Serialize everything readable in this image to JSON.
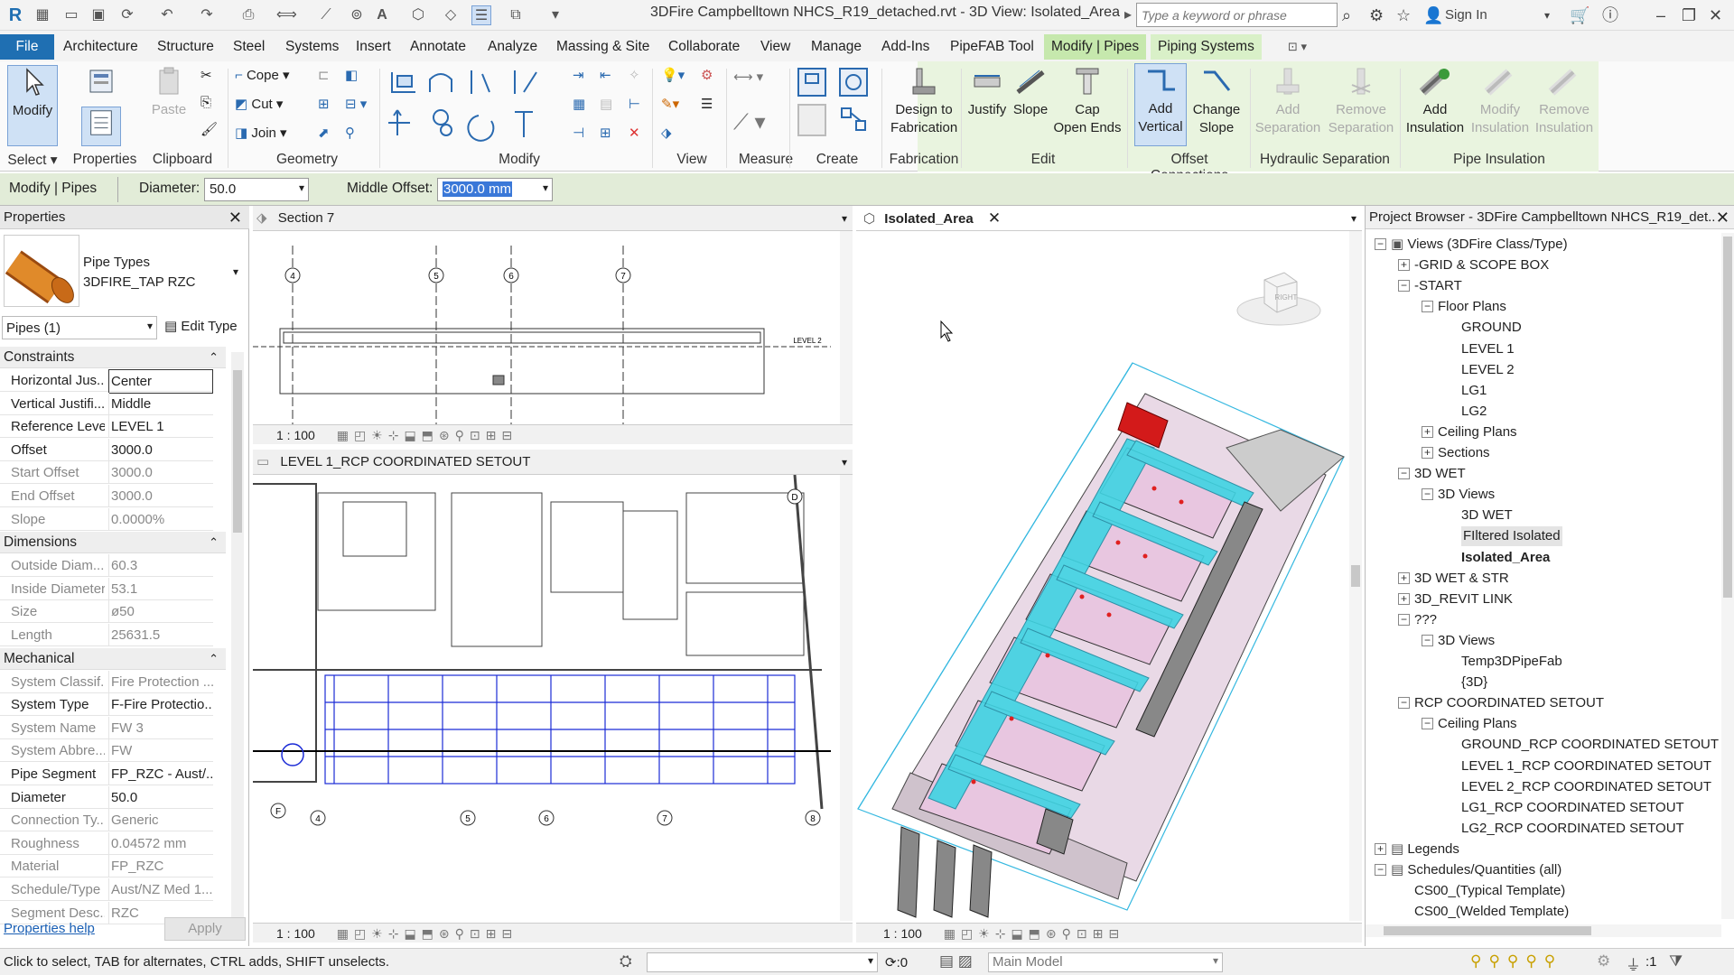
{
  "titlebar": {
    "title": "3DFire Campbelltown NHCS_R19_detached.rvt - 3D View: Isolated_Area",
    "search_placeholder": "Type a keyword or phrase",
    "sign_in": "Sign In"
  },
  "menu": {
    "file": "File",
    "tabs": [
      "Architecture",
      "Structure",
      "Steel",
      "Systems",
      "Insert",
      "Annotate",
      "Analyze",
      "Massing & Site",
      "Collaborate",
      "View",
      "Manage",
      "Add-Ins",
      "PipeFAB Tool"
    ],
    "context_tabs": [
      "Modify | Pipes",
      "Piping Systems"
    ]
  },
  "ribbon": {
    "modify": "Modify",
    "select": "Select",
    "paste": "Paste",
    "properties": "Properties",
    "clipboard": "Clipboard",
    "cope": "Cope",
    "cut": "Cut",
    "join": "Join",
    "geometry": "Geometry",
    "modify_panel": "Modify",
    "view_panel": "View",
    "measure": "Measure",
    "create": "Create",
    "design_to": "Design to",
    "fabrication_btn": "Fabrication",
    "fabrication": "Fabrication",
    "justify": "Justify",
    "slope": "Slope",
    "cap": "Cap",
    "open_ends": "Open Ends",
    "edit": "Edit",
    "add": "Add",
    "vertical": "Vertical",
    "change": "Change",
    "slope2": "Slope",
    "offset_connections": "Offset Connections",
    "add_sep": "Add",
    "separation": "Separation",
    "remove_sep": "Remove",
    "separation2": "Separation",
    "hydraulic_separation": "Hydraulic Separation",
    "add_ins": "Add",
    "insulation": "Insulation",
    "modify_ins": "Modify",
    "insulation2": "Insulation",
    "remove_ins": "Remove",
    "insulation3": "Insulation",
    "pipe_insulation": "Pipe Insulation"
  },
  "optionsbar": {
    "context": "Modify | Pipes",
    "diameter_label": "Diameter:",
    "diameter_value": "50.0",
    "middle_offset_label": "Middle Offset:",
    "middle_offset_value": "3000.0 mm"
  },
  "properties": {
    "title": "Properties",
    "type_family": "Pipe Types",
    "type_name": "3DFIRE_TAP RZC",
    "filter": "Pipes (1)",
    "edit_type": "Edit Type",
    "sections": {
      "constraints": "Constraints",
      "dimensions": "Dimensions",
      "mechanical": "Mechanical"
    },
    "constraints_rows": [
      {
        "k": "Horizontal Jus...",
        "v": "Center"
      },
      {
        "k": "Vertical Justifi...",
        "v": "Middle"
      },
      {
        "k": "Reference Level",
        "v": "LEVEL 1"
      },
      {
        "k": "Offset",
        "v": "3000.0"
      },
      {
        "k": "Start Offset",
        "v": "3000.0"
      },
      {
        "k": "End Offset",
        "v": "3000.0"
      },
      {
        "k": "Slope",
        "v": "0.0000%"
      }
    ],
    "dimension_rows": [
      {
        "k": "Outside Diam...",
        "v": "60.3"
      },
      {
        "k": "Inside Diameter",
        "v": "53.1"
      },
      {
        "k": "Size",
        "v": "ø50"
      },
      {
        "k": "Length",
        "v": "25631.5"
      }
    ],
    "mechanical_rows": [
      {
        "k": "System Classif...",
        "v": "Fire Protection ..."
      },
      {
        "k": "System Type",
        "v": "F-Fire Protectio..."
      },
      {
        "k": "System Name",
        "v": "FW 3"
      },
      {
        "k": "System Abbre...",
        "v": "FW"
      },
      {
        "k": "Pipe Segment",
        "v": "FP_RZC - Aust/..."
      },
      {
        "k": "Diameter",
        "v": "50.0"
      },
      {
        "k": "Connection Ty...",
        "v": "Generic"
      },
      {
        "k": "Roughness",
        "v": "0.04572 mm"
      },
      {
        "k": "Material",
        "v": "FP_RZC"
      },
      {
        "k": "Schedule/Type",
        "v": "Aust/NZ Med 1..."
      },
      {
        "k": "Segment Desc...",
        "v": "RZC"
      }
    ],
    "help": "Properties help",
    "apply": "Apply"
  },
  "views": {
    "section_title": "Section 7",
    "section_scale": "1 : 100",
    "rcp_title": "LEVEL 1_RCP COORDINATED SETOUT",
    "rcp_scale": "1 : 100",
    "iso_title": "Isolated_Area",
    "iso_scale": "1 : 100",
    "viewcube": "RIGHT",
    "grid_top": [
      "4",
      "5",
      "6",
      "7"
    ],
    "grid_bottom": [
      "4",
      "5",
      "6",
      "7",
      "8"
    ],
    "level_label": "LEVEL 2",
    "grid_d": "D",
    "grid_f": "F"
  },
  "browser": {
    "title": "Project Browser - 3DFire Campbelltown NHCS_R19_det...",
    "nodes": [
      {
        "t": "Views (3DFire Class/Type)",
        "l": 0,
        "e": "-",
        "b": false
      },
      {
        "t": "-GRID & SCOPE BOX",
        "l": 1,
        "e": "+",
        "b": false
      },
      {
        "t": "-START",
        "l": 1,
        "e": "-",
        "b": false
      },
      {
        "t": "Floor Plans",
        "l": 2,
        "e": "-",
        "b": false
      },
      {
        "t": "GROUND",
        "l": 3,
        "e": "",
        "b": false
      },
      {
        "t": "LEVEL 1",
        "l": 3,
        "e": "",
        "b": false
      },
      {
        "t": "LEVEL 2",
        "l": 3,
        "e": "",
        "b": false
      },
      {
        "t": "LG1",
        "l": 3,
        "e": "",
        "b": false
      },
      {
        "t": "LG2",
        "l": 3,
        "e": "",
        "b": false
      },
      {
        "t": "Ceiling Plans",
        "l": 2,
        "e": "+",
        "b": false
      },
      {
        "t": "Sections",
        "l": 2,
        "e": "+",
        "b": false
      },
      {
        "t": "3D WET",
        "l": 1,
        "e": "-",
        "b": false
      },
      {
        "t": "3D Views",
        "l": 2,
        "e": "-",
        "b": false
      },
      {
        "t": "3D WET",
        "l": 3,
        "e": "",
        "b": false
      },
      {
        "t": "FIltered Isolated",
        "l": 3,
        "e": "",
        "b": false
      },
      {
        "t": "Isolated_Area",
        "l": 3,
        "e": "",
        "b": true
      },
      {
        "t": "3D WET & STR",
        "l": 1,
        "e": "+",
        "b": false
      },
      {
        "t": "3D_REVIT LINK",
        "l": 1,
        "e": "+",
        "b": false
      },
      {
        "t": "???",
        "l": 1,
        "e": "-",
        "b": false
      },
      {
        "t": "3D Views",
        "l": 2,
        "e": "-",
        "b": false
      },
      {
        "t": "Temp3DPipeFab",
        "l": 3,
        "e": "",
        "b": false
      },
      {
        "t": "{3D}",
        "l": 3,
        "e": "",
        "b": false
      },
      {
        "t": "RCP COORDINATED SETOUT",
        "l": 1,
        "e": "-",
        "b": false
      },
      {
        "t": "Ceiling Plans",
        "l": 2,
        "e": "-",
        "b": false
      },
      {
        "t": "GROUND_RCP COORDINATED SETOUT",
        "l": 3,
        "e": "",
        "b": false
      },
      {
        "t": "LEVEL 1_RCP COORDINATED SETOUT",
        "l": 3,
        "e": "",
        "b": false
      },
      {
        "t": "LEVEL 2_RCP COORDINATED SETOUT",
        "l": 3,
        "e": "",
        "b": false
      },
      {
        "t": "LG1_RCP COORDINATED SETOUT",
        "l": 3,
        "e": "",
        "b": false
      },
      {
        "t": "LG2_RCP COORDINATED SETOUT",
        "l": 3,
        "e": "",
        "b": false
      },
      {
        "t": "Legends",
        "l": 0,
        "e": "+",
        "b": false
      },
      {
        "t": "Schedules/Quantities (all)",
        "l": 0,
        "e": "-",
        "b": false
      },
      {
        "t": "CS00_(Typical Template)",
        "l": 1,
        "e": "",
        "b": false
      },
      {
        "t": "CS00_(Welded Template)",
        "l": 1,
        "e": "",
        "b": false
      }
    ]
  },
  "status": {
    "hint": "Click to select, TAB for alternates, CTRL adds, SHIFT unselects.",
    "zero": ":0",
    "model": "Main Model",
    "filter_count": ":1"
  },
  "colors": {
    "file_tab": "#1f6fb2",
    "context_tab": "#d9f0c8",
    "pipe_cyan": "#3fd4e3",
    "plan_blue": "#1b2bd6"
  }
}
